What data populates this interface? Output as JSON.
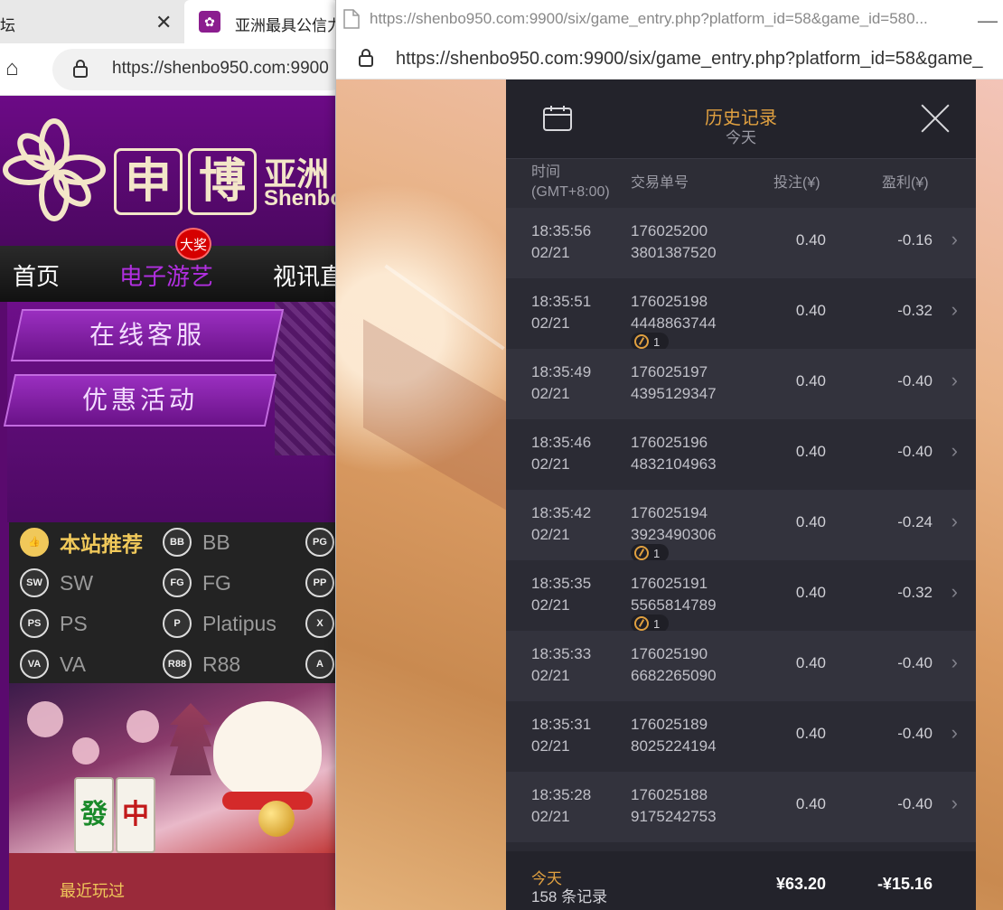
{
  "bg_browser": {
    "tab_inactive_label": "坛",
    "tab_active_label": "亚洲最具公信力",
    "url": "https://shenbo950.com:9900",
    "site": {
      "logo_chars": [
        "申",
        "博"
      ],
      "logo_cn": "亚洲",
      "logo_en": "Shenbo",
      "nav": [
        "首页",
        "电子游艺",
        "视讯直"
      ],
      "jackpot_badge": "大奖",
      "promo_buttons": [
        "在线客服",
        "优惠活动"
      ],
      "providers": [
        {
          "label": "本站推荐",
          "icon": "thumbs-up-icon",
          "icon_text": "👍"
        },
        {
          "label": "BB",
          "icon": "bb-logo-icon",
          "icon_text": "BB"
        },
        {
          "label": "",
          "icon": "pg-logo-icon",
          "icon_text": "PG"
        },
        {
          "label": "SW",
          "icon": "sw-logo-icon",
          "icon_text": "SW"
        },
        {
          "label": "FG",
          "icon": "fg-logo-icon",
          "icon_text": "FG"
        },
        {
          "label": "",
          "icon": "pp-logo-icon",
          "icon_text": "PP"
        },
        {
          "label": "PS",
          "icon": "ps-logo-icon",
          "icon_text": "PS"
        },
        {
          "label": "Platipus",
          "icon": "platipus-logo-icon",
          "icon_text": "P"
        },
        {
          "label": "",
          "icon": "x-logo-icon",
          "icon_text": "X"
        },
        {
          "label": "VA",
          "icon": "va-logo-icon",
          "icon_text": "VA"
        },
        {
          "label": "R88",
          "icon": "r88-logo-icon",
          "icon_text": "R88"
        },
        {
          "label": "",
          "icon": "a-logo-icon",
          "icon_text": "A"
        }
      ],
      "banner_tiles": [
        "發",
        "中"
      ],
      "recent_label": "最近玩过"
    }
  },
  "popup": {
    "title": "https://shenbo950.com:9900/six/game_entry.php?platform_id=58&game_id=580...",
    "url": "https://shenbo950.com:9900/six/game_entry.php?platform_id=58&game_",
    "history": {
      "title": "历史记录",
      "subtitle": "今天",
      "columns": {
        "time_line1": "时间",
        "time_line2": "(GMT+8:00)",
        "order": "交易单号",
        "bet": "投注(¥)",
        "profit": "盈利(¥)"
      },
      "rows": [
        {
          "time": "18:35:56",
          "date": "02/21",
          "order1": "176025200",
          "order2": "3801387520",
          "bet": "0.40",
          "profit": "-0.16",
          "free": ""
        },
        {
          "time": "18:35:51",
          "date": "02/21",
          "order1": "176025198",
          "order2": "4448863744",
          "bet": "0.40",
          "profit": "-0.32",
          "free": "1"
        },
        {
          "time": "18:35:49",
          "date": "02/21",
          "order1": "176025197",
          "order2": "4395129347",
          "bet": "0.40",
          "profit": "-0.40",
          "free": ""
        },
        {
          "time": "18:35:46",
          "date": "02/21",
          "order1": "176025196",
          "order2": "4832104963",
          "bet": "0.40",
          "profit": "-0.40",
          "free": ""
        },
        {
          "time": "18:35:42",
          "date": "02/21",
          "order1": "176025194",
          "order2": "3923490306",
          "bet": "0.40",
          "profit": "-0.24",
          "free": "1"
        },
        {
          "time": "18:35:35",
          "date": "02/21",
          "order1": "176025191",
          "order2": "5565814789",
          "bet": "0.40",
          "profit": "-0.32",
          "free": "1"
        },
        {
          "time": "18:35:33",
          "date": "02/21",
          "order1": "176025190",
          "order2": "6682265090",
          "bet": "0.40",
          "profit": "-0.40",
          "free": ""
        },
        {
          "time": "18:35:31",
          "date": "02/21",
          "order1": "176025189",
          "order2": "8025224194",
          "bet": "0.40",
          "profit": "-0.40",
          "free": ""
        },
        {
          "time": "18:35:28",
          "date": "02/21",
          "order1": "176025188",
          "order2": "9175242753",
          "bet": "0.40",
          "profit": "-0.40",
          "free": ""
        }
      ],
      "footer": {
        "label": "今天",
        "count": "158 条记录",
        "total_bet": "¥63.20",
        "total_profit": "-¥15.16"
      }
    }
  },
  "colors": {
    "accent": "#e0a040",
    "panel_bg": "#2a2a33",
    "site_purple": "#5a0a6e",
    "nav_active": "#b12fe0"
  }
}
